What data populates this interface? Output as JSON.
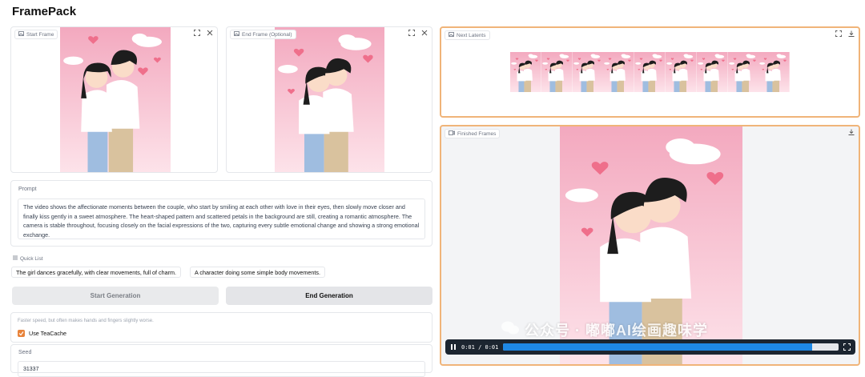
{
  "app": {
    "title": "FramePack"
  },
  "start_frame": {
    "label": "Start Frame"
  },
  "end_frame": {
    "label": "End Frame (Optional)"
  },
  "next_latents": {
    "label": "Next Latents"
  },
  "finished_frames": {
    "label": "Finished Frames"
  },
  "prompt": {
    "label": "Prompt",
    "value": "The video shows the affectionate moments between the couple, who start by smiling at each other with love in their eyes, then slowly move closer and finally kiss gently in a sweet atmosphere. The heart-shaped pattern and scattered petals in the background are still, creating a romantic atmosphere. The camera is stable throughout, focusing closely on the facial expressions of the two, capturing every subtle emotional change and showing a strong emotional exchange."
  },
  "quick_list": {
    "label": "Quick List",
    "items": [
      "The girl dances gracefully, with clear movements, full of charm.",
      "A character doing some simple body movements."
    ]
  },
  "buttons": {
    "start": "Start Generation",
    "end": "End Generation"
  },
  "teacache": {
    "info": "Faster speed, but often makes hands and fingers slightly worse.",
    "label": "Use TeaCache",
    "checked": true
  },
  "seed": {
    "label": "Seed",
    "value": "31337"
  },
  "video": {
    "time": "0:01 / 0:01",
    "progress": 0.92
  },
  "watermark": {
    "text": "公众号 · 嘟嘟AI绘画趣味学"
  },
  "colors": {
    "accent": "#e8833a",
    "active_border": "#f0b479",
    "video_progress": "#1e88e5"
  }
}
